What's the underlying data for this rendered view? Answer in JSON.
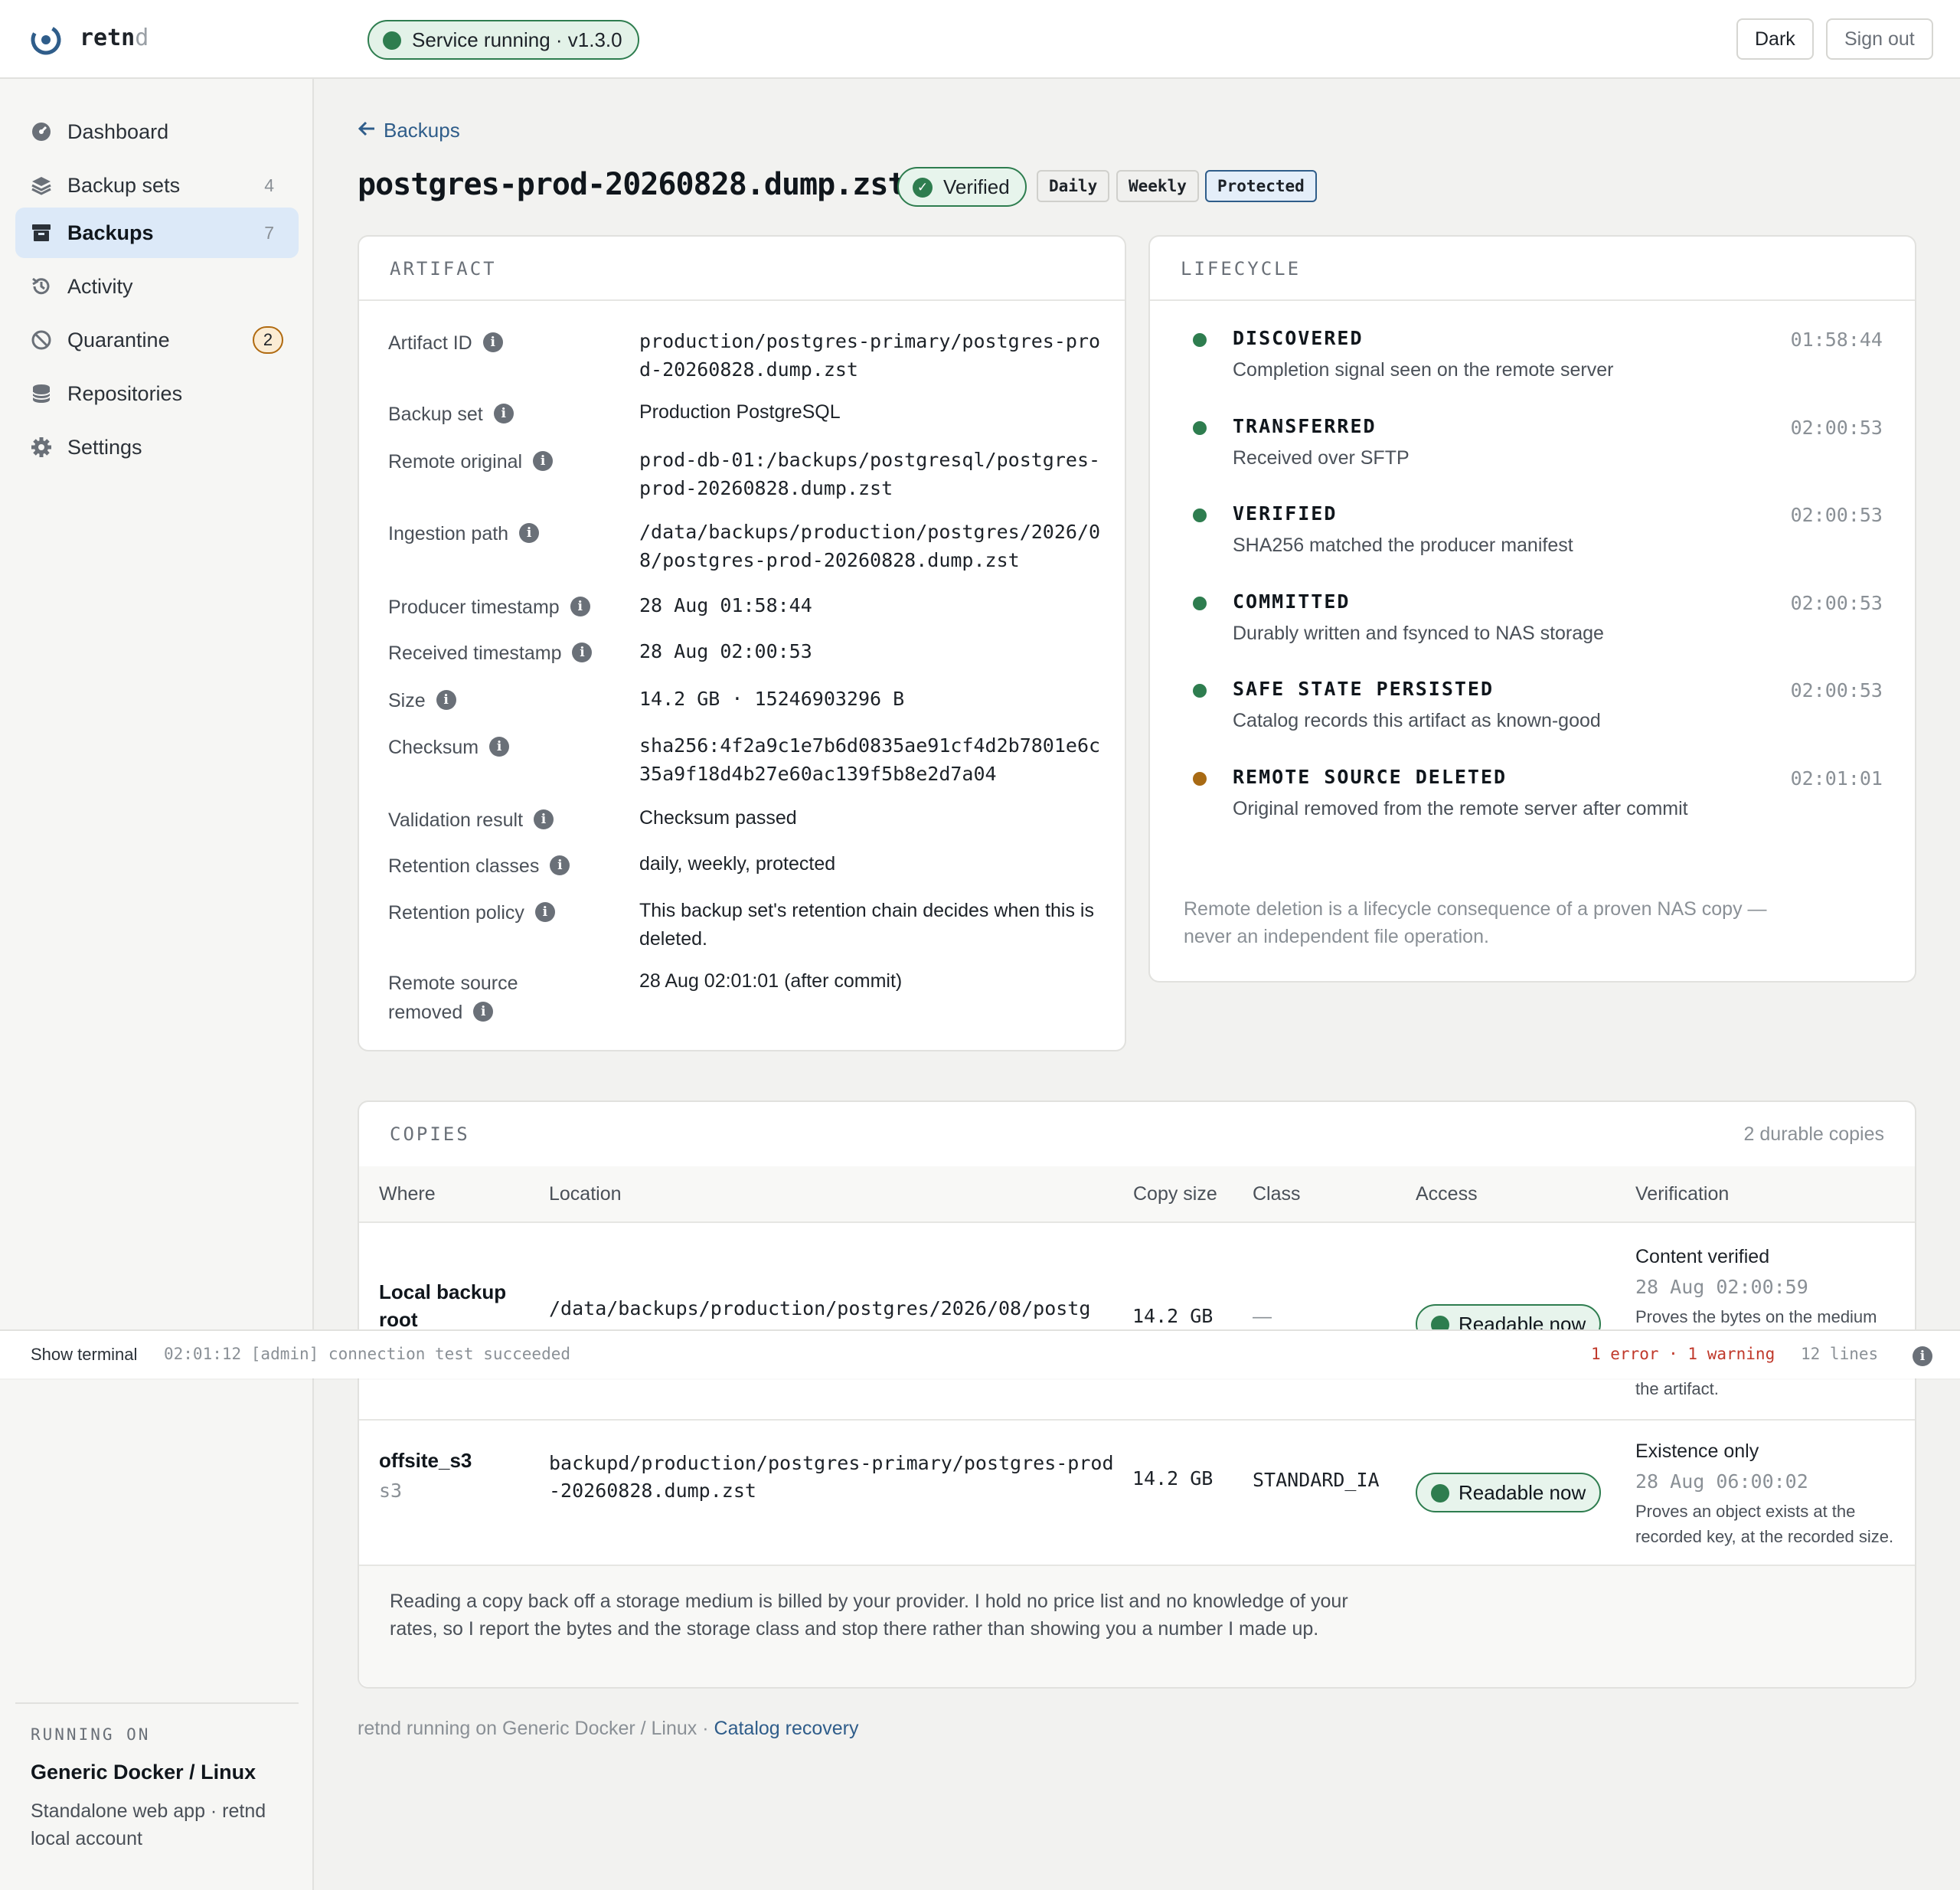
{
  "app": {
    "brand_main": "retn",
    "brand_tail": "d"
  },
  "service_status": "Service running · v1.3.0",
  "header": {
    "theme_label": "Dark",
    "signout_label": "Sign out"
  },
  "sidebar": {
    "items": [
      {
        "label": "Dashboard",
        "icon": "dashboard-icon"
      },
      {
        "label": "Backup sets",
        "count": "4",
        "icon": "layers-icon"
      },
      {
        "label": "Backups",
        "count": "7",
        "icon": "archive-icon"
      },
      {
        "label": "Activity",
        "icon": "history-icon"
      },
      {
        "label": "Quarantine",
        "badge": "2",
        "icon": "block-icon"
      },
      {
        "label": "Repositories",
        "icon": "database-icon"
      },
      {
        "label": "Settings",
        "icon": "gear-icon"
      }
    ],
    "running_on_label": "RUNNING ON",
    "platform_name": "Generic Docker / Linux",
    "platform_desc": "Standalone web app · retnd local account"
  },
  "breadcrumb": {
    "back_label": "Backups"
  },
  "page": {
    "title": "postgres-prod-20260828.dump.zst",
    "status_badge": "Verified",
    "tags": [
      "Daily",
      "Weekly",
      "Protected"
    ]
  },
  "artifact": {
    "title": "ARTIFACT",
    "rows": [
      {
        "label": "Artifact ID",
        "value": "production/postgres-primary/postgres-prod-20260828.dump.zst"
      },
      {
        "label": "Backup set",
        "value": "Production PostgreSQL"
      },
      {
        "label": "Remote original",
        "value": "prod-db-01:/backups/postgresql/postgres-prod-20260828.dump.zst"
      },
      {
        "label": "Ingestion path",
        "value": "/data/backups/production/postgres/2026/08/postgres-prod-20260828.dump.zst"
      },
      {
        "label": "Producer timestamp",
        "value": "28 Aug 01:58:44"
      },
      {
        "label": "Received timestamp",
        "value": "28 Aug 02:00:53"
      },
      {
        "label": "Size",
        "value": "14.2 GB · 15246903296 B"
      },
      {
        "label": "Checksum",
        "value": "sha256:4f2a9c1e7b6d0835ae91cf4d2b7801e6c35a9f18d4b27e60ac139f5b8e2d7a04"
      },
      {
        "label": "Validation result",
        "value": "Checksum passed"
      },
      {
        "label": "Retention classes",
        "value": "daily, weekly, protected"
      },
      {
        "label": "Retention policy",
        "value": "This backup set's retention chain decides when this is deleted."
      },
      {
        "label": "Remote source removed",
        "value": "28 Aug 02:01:01 (after commit)"
      }
    ]
  },
  "lifecycle": {
    "title": "LIFECYCLE",
    "steps": [
      {
        "title": "DISCOVERED",
        "desc": "Completion signal seen on the remote server",
        "time": "01:58:44",
        "color": "#2e7d4f"
      },
      {
        "title": "TRANSFERRED",
        "desc": "Received over SFTP",
        "time": "02:00:53",
        "color": "#2e7d4f"
      },
      {
        "title": "VERIFIED",
        "desc": "SHA256 matched the producer manifest",
        "time": "02:00:53",
        "color": "#2e7d4f"
      },
      {
        "title": "COMMITTED",
        "desc": "Durably written and fsynced to NAS storage",
        "time": "02:00:53",
        "color": "#2e7d4f"
      },
      {
        "title": "SAFE STATE PERSISTED",
        "desc": "Catalog records this artifact as known-good",
        "time": "02:00:53",
        "color": "#2e7d4f"
      },
      {
        "title": "REMOTE SOURCE DELETED",
        "desc": "Original removed from the remote server after commit",
        "time": "02:01:01",
        "color": "#a86a14"
      }
    ],
    "note": "Remote deletion is a lifecycle consequence of a proven NAS copy — never an independent file operation."
  },
  "copies": {
    "title": "COPIES",
    "count": "2 durable copies",
    "headers": [
      "Where",
      "Location",
      "Copy size",
      "Class",
      "Access",
      "Verification"
    ],
    "rows": [
      {
        "where": "Local backup root",
        "where_sub": "",
        "location": "/data/backups/production/postgres/2026/08/postg",
        "size": "14.2 GB",
        "class": "—",
        "access": "Readable now",
        "verification_title": "Content verified",
        "verification_time": "28 Aug 02:00:59",
        "verification_desc": "Proves the bytes on the medium",
        "verification_desc_tail": "the artifact."
      },
      {
        "where": "offsite_s3",
        "where_sub": "s3",
        "location": "backupd/production/postgres-primary/postgres-prod-20260828.dump.zst",
        "size": "14.2 GB",
        "class": "STANDARD_IA",
        "access": "Readable now",
        "verification_title": "Existence only",
        "verification_time": "28 Aug 06:00:02",
        "verification_desc": "Proves an object exists at the recorded key, at the recorded size."
      }
    ],
    "note": "Reading a copy back off a storage medium is billed by your provider. I hold no price list and no knowledge of your rates, so I report the bytes and the storage class and stop there rather than showing you a number I made up."
  },
  "footer": {
    "text": "retnd running on Generic Docker / Linux · ",
    "link": "Catalog recovery"
  },
  "terminal": {
    "toggle_label": "Show terminal",
    "last_line": "02:01:12 [admin] connection test succeeded",
    "errors": "1 error · 1 warning",
    "lines": "12 lines"
  },
  "colors": {
    "accent": "#2f5d8a",
    "success": "#2e7d4f",
    "warning": "#a86a14",
    "error": "#c0392b"
  }
}
